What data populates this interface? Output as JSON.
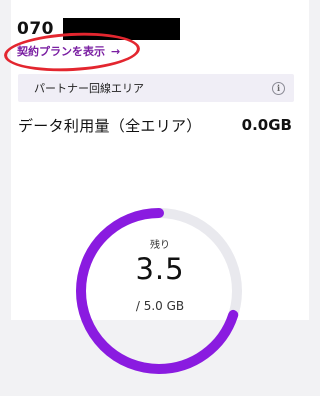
{
  "header": {
    "phone_number_visible": "070"
  },
  "plan_link": {
    "label": "契約プランを表示",
    "arrow": "→"
  },
  "network": {
    "label": "パートナー回線エリア",
    "info_icon": "info-icon",
    "info_glyph": "i"
  },
  "usage": {
    "label": "データ利用量（全エリア）",
    "value": "0.0GB"
  },
  "remaining": {
    "label": "残り",
    "value": "3.5",
    "total": "/ 5.0 GB",
    "fraction_remaining": 0.7
  },
  "colors": {
    "accent": "#7a1fa2",
    "gauge_fill": "#8a1be0",
    "gauge_track": "#e9e9ee",
    "highlight": "#e3262f"
  }
}
